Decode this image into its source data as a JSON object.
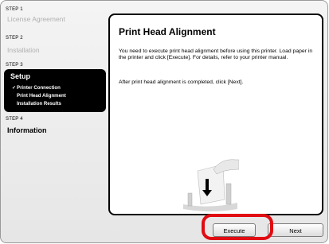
{
  "sidebar": {
    "step1": {
      "label": "STEP 1",
      "title": "License Agreement"
    },
    "step2": {
      "label": "STEP 2",
      "title": "Installation"
    },
    "step3": {
      "label": "STEP 3",
      "title": "Setup",
      "items": [
        {
          "check": "✓",
          "label": "Printer Connection"
        },
        {
          "check": "",
          "label": "Print Head Alignment"
        },
        {
          "check": "",
          "label": "Installation Results"
        }
      ]
    },
    "step4": {
      "label": "STEP 4",
      "title": "Information"
    }
  },
  "panel": {
    "title": "Print Head Alignment",
    "paragraph1": "You need to execute print head alignment before using this printer. Load paper in the printer and click [Execute]. For details, refer to your printer manual.",
    "paragraph2": "After print head alignment is completed, click [Next]."
  },
  "buttons": {
    "execute": "Execute",
    "next": "Next"
  },
  "colors": {
    "highlight": "#e10b12",
    "setup_bg": "#000000"
  },
  "icons": {
    "illustration": "paper-load-icon"
  }
}
